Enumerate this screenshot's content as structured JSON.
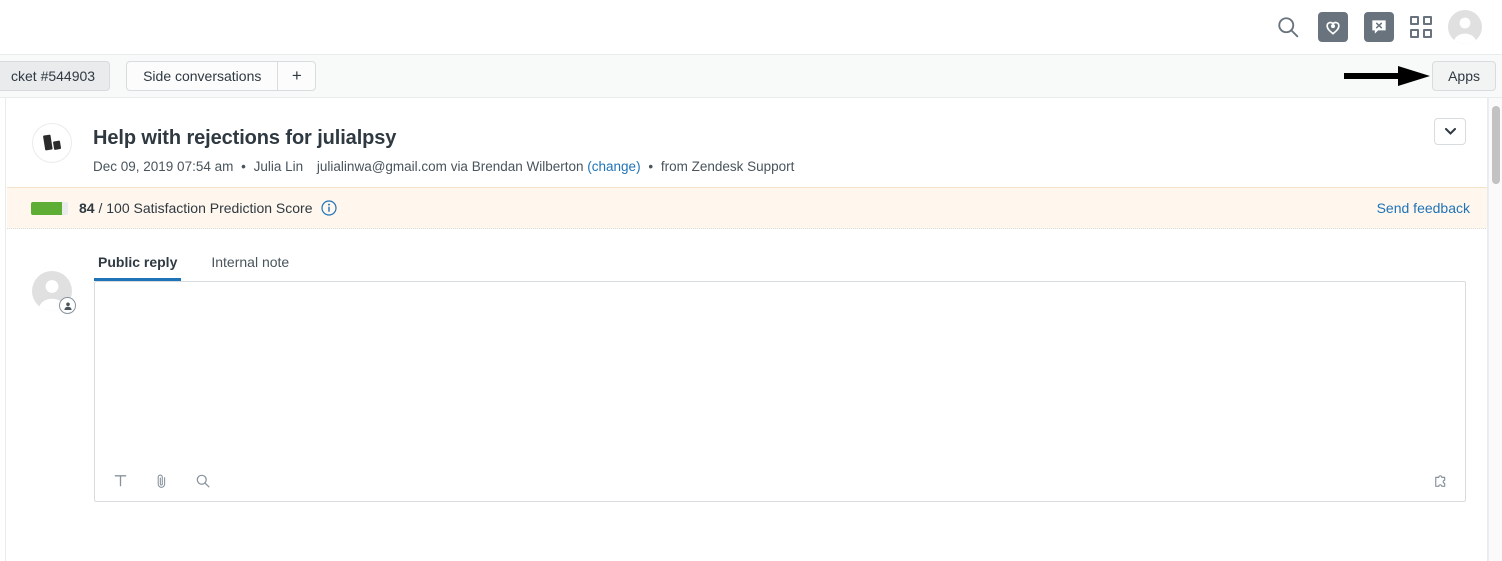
{
  "header": {
    "search_icon": "search-icon",
    "product_icons": [
      {
        "name": "guide-icon",
        "label": "Guide"
      },
      {
        "name": "chat-icon",
        "label": "Chat"
      }
    ],
    "products_grid_icon": "apps-grid-icon",
    "user_avatar": "user-avatar"
  },
  "tabstrip": {
    "ticket_tab_label": "cket #544903",
    "side_conversations_label": "Side conversations",
    "add_tab_label": "+",
    "apps_button_label": "Apps"
  },
  "ticket": {
    "title": "Help with rejections for julialpsy",
    "timestamp": "Dec 09, 2019 07:54 am",
    "requester": "Julia Lin",
    "email": "julialinwa@gmail.com",
    "via_text": "via Brendan Wilberton",
    "change_link": "(change)",
    "channel": "from Zendesk Support",
    "separator": "•",
    "collapse_icon": "chevron-down-icon"
  },
  "satisfaction": {
    "score": 84,
    "max": 100,
    "score_display": "84",
    "label": "/ 100 Satisfaction Prediction Score",
    "info_icon": "info-icon",
    "send_feedback_label": "Send feedback",
    "bar_color": "#5eae36",
    "track_color": "#e9ebed",
    "banner_bg": "#fff7ed",
    "percent": 84
  },
  "composer": {
    "tabs": [
      {
        "label": "Public reply",
        "active": true
      },
      {
        "label": "Internal note",
        "active": false
      }
    ],
    "body_value": "",
    "toolbar": [
      {
        "name": "text-format-icon",
        "label": "T"
      },
      {
        "name": "attachment-icon",
        "label": "Attach"
      },
      {
        "name": "search-knowledge-icon",
        "label": "Search"
      }
    ],
    "apps_icon": "puzzle-piece-icon",
    "avatar": "agent-avatar",
    "avatar_badge": "user-badge-icon"
  },
  "annotation": {
    "arrow": "pointer-arrow",
    "color": "#000000"
  },
  "theme": {
    "accent": "#1f73b7",
    "text": "#2f3941",
    "muted": "#68737d",
    "border": "#d8dcde"
  }
}
